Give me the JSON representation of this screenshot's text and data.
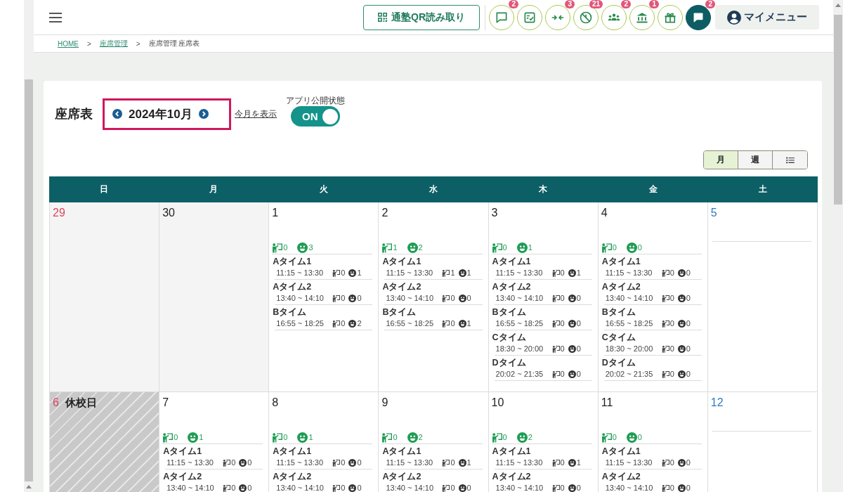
{
  "header": {
    "qr_button": {
      "label": "通塾QR読み取り"
    },
    "icon_buttons": [
      {
        "kind": "outline",
        "badge": "2"
      },
      {
        "kind": "outline"
      },
      {
        "kind": "outline",
        "badge": "3"
      },
      {
        "kind": "outline",
        "badge": "21"
      },
      {
        "kind": "outline",
        "badge": "2"
      },
      {
        "kind": "outline",
        "badge": "1"
      },
      {
        "kind": "outline"
      },
      {
        "kind": "filled",
        "badge": "2"
      }
    ],
    "my_menu": {
      "label": "マイメニュー"
    }
  },
  "breadcrumb": [
    {
      "kind": "link",
      "label": "HOME"
    },
    {
      "kind": "separator",
      "label": ">"
    },
    {
      "kind": "link",
      "label": "座席管理"
    },
    {
      "kind": "separator",
      "label": ">"
    },
    {
      "kind": "current",
      "label": "座席管理 座席表"
    }
  ],
  "page": {
    "title": "座席表",
    "month_nav": {
      "label": "2024年10月",
      "highlighted": true
    },
    "today_link": "今月を表示",
    "publish_toggle": {
      "label": "アプリ公開状態",
      "text": "ON",
      "on": true
    },
    "view_switch": [
      {
        "kind": "text",
        "label": "月",
        "selected": true
      },
      {
        "kind": "text",
        "label": "週",
        "selected": false
      },
      {
        "kind": "list",
        "selected": false
      }
    ]
  },
  "calendar": {
    "weekdays": [
      "日",
      "月",
      "火",
      "水",
      "木",
      "金",
      "土"
    ],
    "weeks": [
      [
        {
          "kind": "outside",
          "date": "29"
        },
        {
          "kind": "outside",
          "date": "30"
        },
        {
          "kind": "open",
          "date": "1",
          "summary": {
            "teachers": "0",
            "students": "3"
          },
          "slots": [
            {
              "name": "Aタイム1",
              "time": "11:15 ~ 13:30",
              "teachers": "0",
              "students": "1"
            },
            {
              "name": "Aタイム2",
              "time": "13:40 ~ 14:10",
              "teachers": "0",
              "students": "0"
            },
            {
              "name": "Bタイム",
              "time": "16:55 ~ 18:25",
              "teachers": "0",
              "students": "2"
            }
          ]
        },
        {
          "kind": "open",
          "date": "2",
          "summary": {
            "teachers": "1",
            "students": "2"
          },
          "slots": [
            {
              "name": "Aタイム1",
              "time": "11:15 ~ 13:30",
              "teachers": "1",
              "students": "1"
            },
            {
              "name": "Aタイム2",
              "time": "13:40 ~ 14:10",
              "teachers": "0",
              "students": "0"
            },
            {
              "name": "Bタイム",
              "time": "16:55 ~ 18:25",
              "teachers": "0",
              "students": "1"
            }
          ]
        },
        {
          "kind": "open",
          "date": "3",
          "summary": {
            "teachers": "0",
            "students": "1"
          },
          "slots": [
            {
              "name": "Aタイム1",
              "time": "11:15 ~ 13:30",
              "teachers": "0",
              "students": "1"
            },
            {
              "name": "Aタイム2",
              "time": "13:40 ~ 14:10",
              "teachers": "0",
              "students": "0"
            },
            {
              "name": "Bタイム",
              "time": "16:55 ~ 18:25",
              "teachers": "0",
              "students": "0"
            },
            {
              "name": "Cタイム",
              "time": "18:30 ~ 20:00",
              "teachers": "0",
              "students": "0"
            },
            {
              "name": "Dタイム",
              "time": "20:02 ~ 21:35",
              "teachers": "0",
              "students": "0"
            }
          ]
        },
        {
          "kind": "open",
          "date": "4",
          "summary": {
            "teachers": "0",
            "students": "0"
          },
          "slots": [
            {
              "name": "Aタイム1",
              "time": "11:15 ~ 13:30",
              "teachers": "0",
              "students": "0"
            },
            {
              "name": "Aタイム2",
              "time": "13:40 ~ 14:10",
              "teachers": "0",
              "students": "0"
            },
            {
              "name": "Bタイム",
              "time": "16:55 ~ 18:25",
              "teachers": "0",
              "students": "0"
            },
            {
              "name": "Cタイム",
              "time": "18:30 ~ 20:00",
              "teachers": "0",
              "students": "0"
            },
            {
              "name": "Dタイム",
              "time": "20:02 ~ 21:35",
              "teachers": "0",
              "students": "0"
            }
          ]
        },
        {
          "kind": "open",
          "date": "5"
        }
      ],
      [
        {
          "kind": "closed",
          "date": "6",
          "note": "休校日"
        },
        {
          "kind": "open",
          "date": "7",
          "summary": {
            "teachers": "0",
            "students": "1"
          },
          "slots": [
            {
              "name": "Aタイム1",
              "time": "11:15 ~ 13:30",
              "teachers": "0",
              "students": "0"
            },
            {
              "name": "Aタイム2",
              "time": "13:40 ~ 14:10",
              "teachers": "0",
              "students": "0"
            }
          ]
        },
        {
          "kind": "open",
          "date": "8",
          "summary": {
            "teachers": "0",
            "students": "1"
          },
          "slots": [
            {
              "name": "Aタイム1",
              "time": "11:15 ~ 13:30",
              "teachers": "0",
              "students": "0"
            },
            {
              "name": "Aタイム2",
              "time": "13:40 ~ 14:10",
              "teachers": "0",
              "students": "0"
            }
          ]
        },
        {
          "kind": "open",
          "date": "9",
          "summary": {
            "teachers": "0",
            "students": "2"
          },
          "slots": [
            {
              "name": "Aタイム1",
              "time": "11:15 ~ 13:30",
              "teachers": "0",
              "students": "1"
            },
            {
              "name": "Aタイム2",
              "time": "13:40 ~ 14:10",
              "teachers": "0",
              "students": "0"
            }
          ]
        },
        {
          "kind": "open",
          "date": "10",
          "summary": {
            "teachers": "0",
            "students": "2"
          },
          "slots": [
            {
              "name": "Aタイム1",
              "time": "11:15 ~ 13:30",
              "teachers": "0",
              "students": "1"
            },
            {
              "name": "Aタイム2",
              "time": "13:40 ~ 14:10",
              "teachers": "0",
              "students": "0"
            }
          ]
        },
        {
          "kind": "open",
          "date": "11",
          "summary": {
            "teachers": "0",
            "students": "0"
          },
          "slots": [
            {
              "name": "Aタイム1",
              "time": "11:15 ~ 13:30",
              "teachers": "0",
              "students": "0"
            },
            {
              "name": "Aタイム2",
              "time": "13:40 ~ 14:10",
              "teachers": "0",
              "students": "0"
            }
          ]
        },
        {
          "kind": "open",
          "date": "12"
        }
      ]
    ]
  }
}
